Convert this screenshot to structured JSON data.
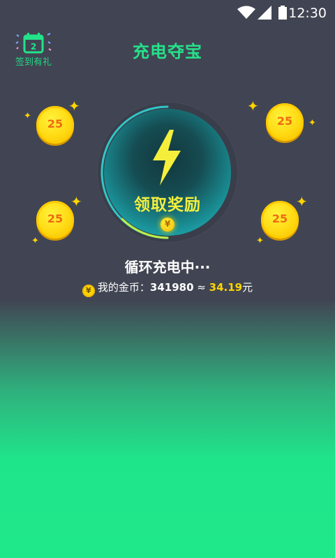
{
  "status_bar": {
    "time": "12:30",
    "icons": [
      "wifi-icon",
      "signal-icon",
      "battery-icon"
    ]
  },
  "header": {
    "title": "充电夺宝"
  },
  "checkin": {
    "day": "2",
    "label": "签到有礼",
    "icon": "calendar-icon"
  },
  "coins": [
    {
      "value": "25"
    },
    {
      "value": "25"
    },
    {
      "value": "25"
    },
    {
      "value": "25"
    }
  ],
  "charger": {
    "button_label": "领取奖励",
    "icon": "lightning-bolt-icon",
    "mini_coin_symbol": "¥"
  },
  "status_text": "循环充电中···",
  "balance": {
    "coin_symbol": "¥",
    "label": "我的金币：",
    "coins": "341980",
    "approx": "≈",
    "money": "34.19",
    "unit": "元"
  },
  "colors": {
    "background_top": "#414553",
    "background_bottom": "#1fe88a",
    "accent_green": "#24e28a",
    "coin_yellow": "#ffd912",
    "claim_text": "#f5ef3c"
  }
}
